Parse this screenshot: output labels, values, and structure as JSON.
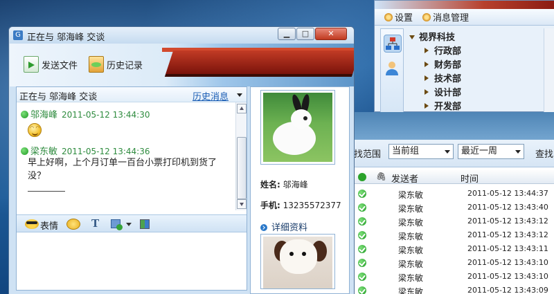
{
  "back_window": {
    "settings_label": "设置",
    "message_mgmt_label": "消息管理",
    "tree": {
      "root": "视界科技",
      "items": [
        "行政部",
        "财务部",
        "技术部",
        "设计部",
        "开发部"
      ]
    }
  },
  "history_window": {
    "scope_label": "找范围",
    "scope_value": "当前组",
    "period_value": "最近一周",
    "search_label": "查找",
    "columns": {
      "sender": "发送者",
      "time": "时间"
    },
    "rows": [
      {
        "sender": "梁东敏",
        "time": "2011-05-12 13:44:37"
      },
      {
        "sender": "梁东敏",
        "time": "2011-05-12 13:43:40"
      },
      {
        "sender": "梁东敏",
        "time": "2011-05-12 13:43:12"
      },
      {
        "sender": "梁东敏",
        "time": "2011-05-12 13:43:12"
      },
      {
        "sender": "梁东敏",
        "time": "2011-05-12 13:43:11"
      },
      {
        "sender": "梁东敏",
        "time": "2011-05-12 13:43:10"
      },
      {
        "sender": "梁东敏",
        "time": "2011-05-12 13:43:10"
      },
      {
        "sender": "梁东敏",
        "time": "2011-05-12 13:43:09"
      }
    ]
  },
  "chat_window": {
    "title": "正在与 邬海峰 交谈",
    "toolbar": {
      "send_file": "发送文件",
      "history": "历史记录"
    },
    "header": {
      "talking_with": "正在与  邬海峰  交谈",
      "history_link": "历史消息"
    },
    "messages": [
      {
        "name": "邬海峰",
        "time": "2011-05-12 13:44:30"
      },
      {
        "name": "梁东敏",
        "time": "2011-05-12 13:44:36",
        "text": "早上好啊，上个月订单一百台小票打印机到货了没？"
      }
    ],
    "input_toolbar": {
      "emoji_label": "表情"
    }
  },
  "profile": {
    "name_label": "姓名:",
    "name_value": "邬海峰",
    "phone_label": "手机:",
    "phone_value": "13235572377",
    "detail_link": "详细资料"
  }
}
